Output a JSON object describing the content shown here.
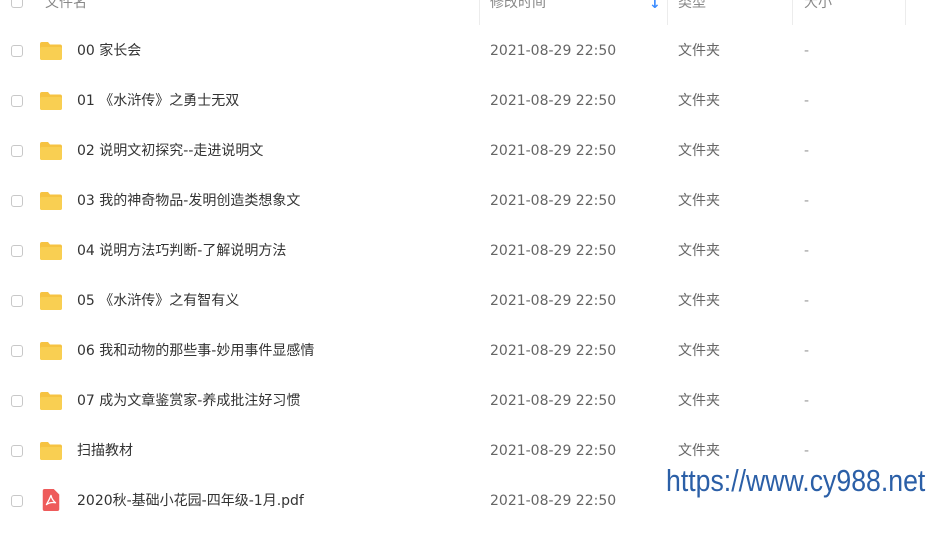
{
  "header": {
    "name_label": "文件名",
    "time_label": "修改时间",
    "sort_icon": "↓",
    "type_label": "类型",
    "size_label": "大小"
  },
  "colors": {
    "folder": "#f6c342",
    "pdf": "#ee5b5b",
    "sort_arrow": "#3b8cff",
    "watermark": "#2b5fa7"
  },
  "files": [
    {
      "name": "00 家长会",
      "modified": "2021-08-29 22:50",
      "type": "文件夹",
      "size": "-",
      "icon": "folder-icon"
    },
    {
      "name": "01 《水浒传》之勇士无双",
      "modified": "2021-08-29 22:50",
      "type": "文件夹",
      "size": "-",
      "icon": "folder-icon"
    },
    {
      "name": "02 说明文初探究--走进说明文",
      "modified": "2021-08-29 22:50",
      "type": "文件夹",
      "size": "-",
      "icon": "folder-icon"
    },
    {
      "name": "03 我的神奇物品-发明创造类想象文",
      "modified": "2021-08-29 22:50",
      "type": "文件夹",
      "size": "-",
      "icon": "folder-icon"
    },
    {
      "name": "04 说明方法巧判断-了解说明方法",
      "modified": "2021-08-29 22:50",
      "type": "文件夹",
      "size": "-",
      "icon": "folder-icon"
    },
    {
      "name": "05 《水浒传》之有智有义",
      "modified": "2021-08-29 22:50",
      "type": "文件夹",
      "size": "-",
      "icon": "folder-icon"
    },
    {
      "name": "06 我和动物的那些事-妙用事件显感情",
      "modified": "2021-08-29 22:50",
      "type": "文件夹",
      "size": "-",
      "icon": "folder-icon"
    },
    {
      "name": "07 成为文章鉴赏家-养成批注好习惯",
      "modified": "2021-08-29 22:50",
      "type": "文件夹",
      "size": "-",
      "icon": "folder-icon"
    },
    {
      "name": "扫描教材",
      "modified": "2021-08-29 22:50",
      "type": "文件夹",
      "size": "-",
      "icon": "folder-icon"
    },
    {
      "name": "2020秋-基础小花园-四年级-1月.pdf",
      "modified": "2021-08-29 22:50",
      "type": "",
      "size": "",
      "icon": "pdf-icon"
    }
  ],
  "watermark": "https://www.cy988.net"
}
